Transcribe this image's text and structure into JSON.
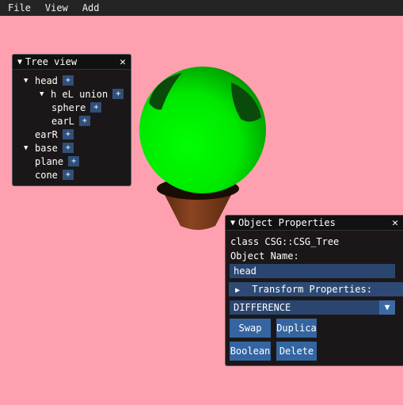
{
  "menu": {
    "items": [
      "File",
      "View",
      "Add"
    ]
  },
  "tree_view": {
    "title": "Tree view",
    "close": "✕",
    "rows": [
      {
        "label": "head",
        "plus": "+",
        "expanded": true
      },
      {
        "label": "h eL union",
        "plus": "+",
        "expanded": true
      },
      {
        "label": "sphere",
        "plus": "+"
      },
      {
        "label": "earL",
        "plus": "+"
      },
      {
        "label": "earR",
        "plus": "+"
      },
      {
        "label": "base",
        "plus": "+",
        "expanded": true
      },
      {
        "label": "plane",
        "plus": "+"
      },
      {
        "label": "cone",
        "plus": "+"
      }
    ]
  },
  "props": {
    "title": "Object Properties",
    "close": "✕",
    "class_label": "class CSG::CSG_Tree",
    "name_label": "Object Name:",
    "name_value": "head",
    "transform_header": "Transform Properties:",
    "operation": "DIFFERENCE",
    "buttons": {
      "swap": "Swap",
      "duplicate": "Duplica",
      "boolean": "Boolean",
      "delete": "Delete"
    }
  },
  "colors": {
    "background": "#ffa0b0",
    "panel": "#121212",
    "button": "#3465a0",
    "sphere": "#00ff00",
    "cone": "#7a3a1a"
  }
}
